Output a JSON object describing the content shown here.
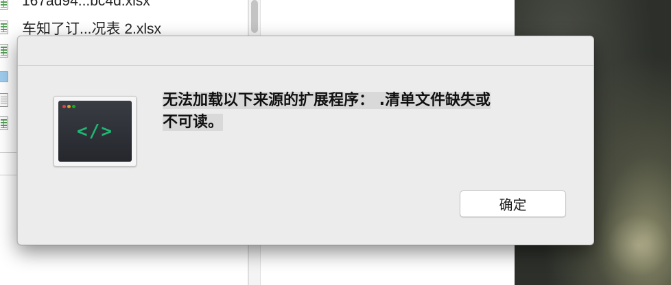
{
  "finder": {
    "files": [
      {
        "name": "167ad94...bc4d.xlsx",
        "kind": "xlsx"
      },
      {
        "name": "车知了订...况表 2.xlsx",
        "kind": "xlsx"
      },
      {
        "name": "",
        "kind": "xlsx"
      },
      {
        "name": "",
        "kind": "folder"
      },
      {
        "name": "",
        "kind": "doc"
      },
      {
        "name": "",
        "kind": "xlsx"
      }
    ]
  },
  "dialog": {
    "message": "无法加载以下来源的扩展程序：.清单文件缺失或不可读。",
    "message_line1": "无法加载以下来源的扩展程序： .清单文件缺失或",
    "message_line2": "不可读。",
    "app_icon": "terminal-code-icon",
    "code_glyph": "</>",
    "ok_button_label": "确定"
  },
  "colors": {
    "dialog_bg": "#ececec",
    "code_green": "#22b573",
    "terminal_bg": "#2b2d33"
  }
}
